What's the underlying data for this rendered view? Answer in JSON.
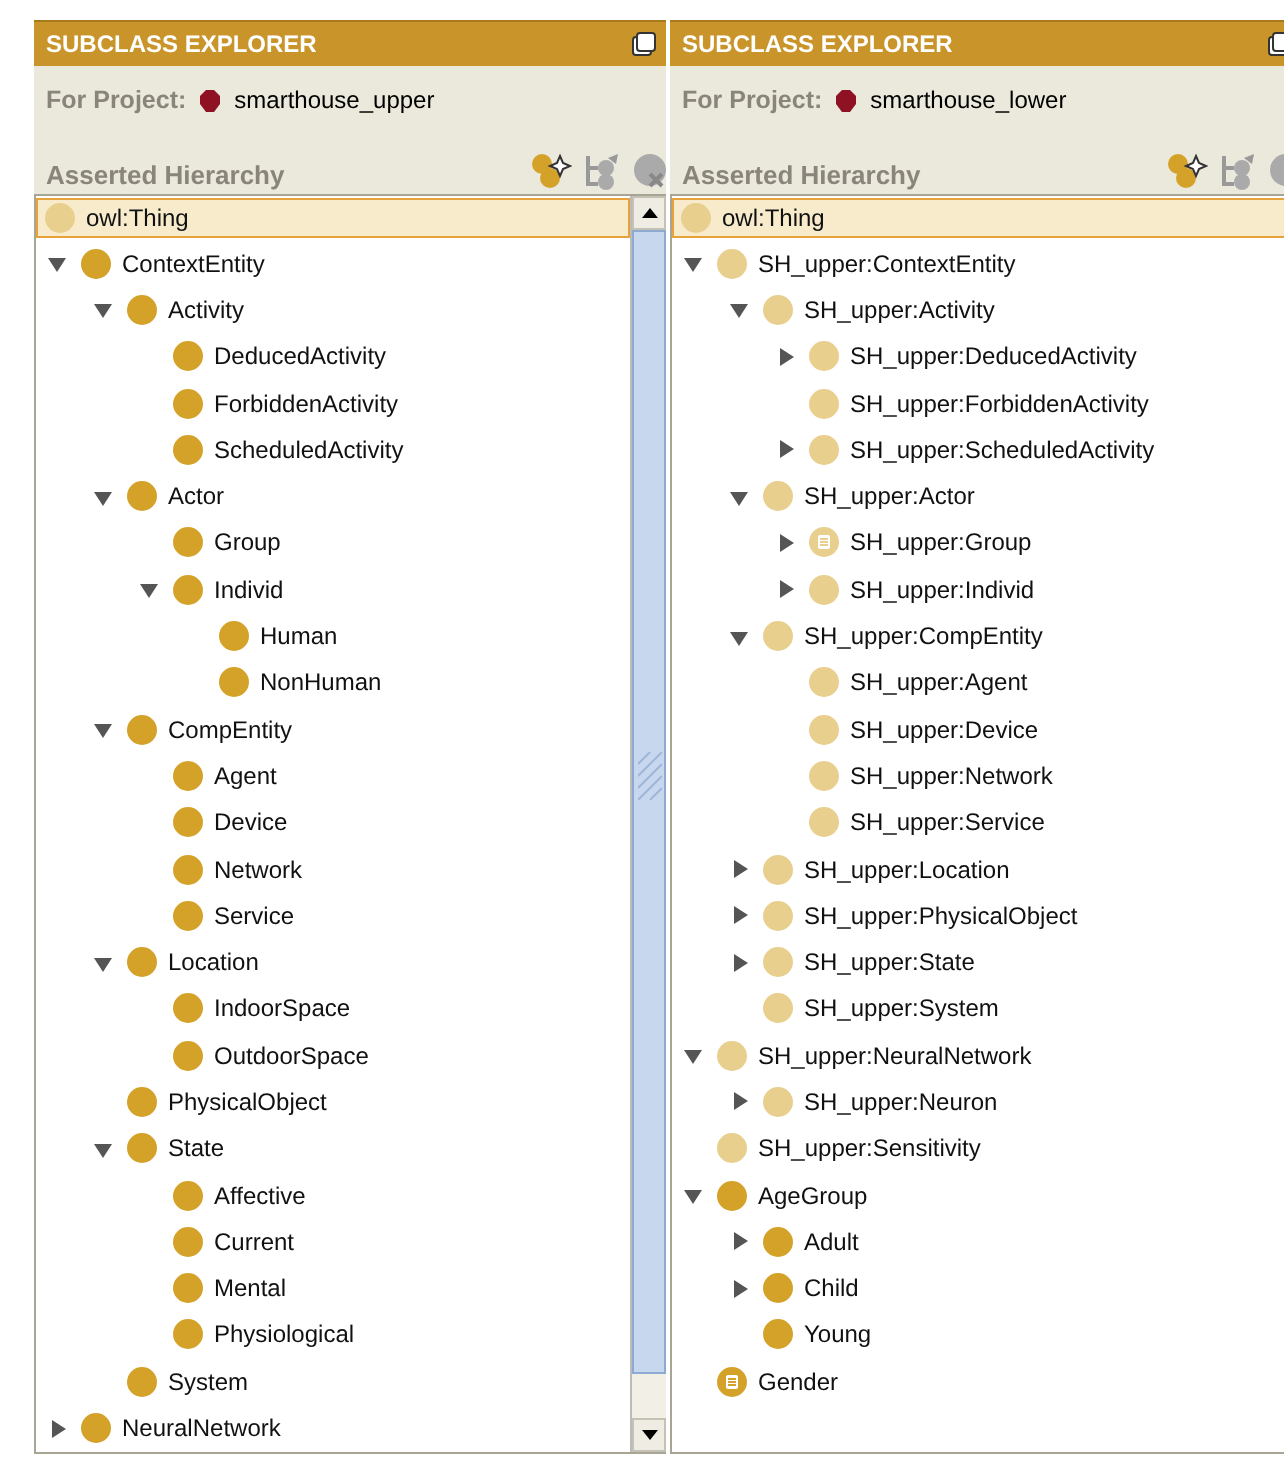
{
  "panels": [
    {
      "title": "SUBCLASS EXPLORER",
      "project_label": "For Project:",
      "project": "smarthouse_upper",
      "hierarchy_label": "Asserted Hierarchy",
      "scrollbar": true,
      "root": {
        "name": "owl:Thing",
        "kind": "system",
        "selected": true
      },
      "nodes": [
        {
          "name": "ContextEntity",
          "kind": "class",
          "expandable": true,
          "expanded": true,
          "children": [
            {
              "name": "Activity",
              "kind": "class",
              "expandable": true,
              "expanded": true,
              "children": [
                {
                  "name": "DeducedActivity",
                  "kind": "class",
                  "expandable": false
                },
                {
                  "name": "ForbiddenActivity",
                  "kind": "class",
                  "expandable": false
                },
                {
                  "name": "ScheduledActivity",
                  "kind": "class",
                  "expandable": false
                }
              ]
            },
            {
              "name": "Actor",
              "kind": "class",
              "expandable": true,
              "expanded": true,
              "children": [
                {
                  "name": "Group",
                  "kind": "class",
                  "expandable": false
                },
                {
                  "name": "Individ",
                  "kind": "class",
                  "expandable": true,
                  "expanded": true,
                  "children": [
                    {
                      "name": "Human",
                      "kind": "class",
                      "expandable": false
                    },
                    {
                      "name": "NonHuman",
                      "kind": "class",
                      "expandable": false
                    }
                  ]
                }
              ]
            },
            {
              "name": "CompEntity",
              "kind": "class",
              "expandable": true,
              "expanded": true,
              "children": [
                {
                  "name": "Agent",
                  "kind": "class",
                  "expandable": false
                },
                {
                  "name": "Device",
                  "kind": "class",
                  "expandable": false
                },
                {
                  "name": "Network",
                  "kind": "class",
                  "expandable": false
                },
                {
                  "name": "Service",
                  "kind": "class",
                  "expandable": false
                }
              ]
            },
            {
              "name": "Location",
              "kind": "class",
              "expandable": true,
              "expanded": true,
              "children": [
                {
                  "name": "IndoorSpace",
                  "kind": "class",
                  "expandable": false
                },
                {
                  "name": "OutdoorSpace",
                  "kind": "class",
                  "expandable": false
                }
              ]
            },
            {
              "name": "PhysicalObject",
              "kind": "class",
              "expandable": false
            },
            {
              "name": "State",
              "kind": "class",
              "expandable": true,
              "expanded": true,
              "children": [
                {
                  "name": "Affective",
                  "kind": "class",
                  "expandable": false
                },
                {
                  "name": "Current",
                  "kind": "class",
                  "expandable": false
                },
                {
                  "name": "Mental",
                  "kind": "class",
                  "expandable": false
                },
                {
                  "name": "Physiological",
                  "kind": "class",
                  "expandable": false
                }
              ]
            },
            {
              "name": "System",
              "kind": "class",
              "expandable": false
            }
          ]
        },
        {
          "name": "NeuralNetwork",
          "kind": "class",
          "expandable": true,
          "expanded": false
        }
      ]
    },
    {
      "title": "SUBCLASS EXPLORER",
      "project_label": "For Project:",
      "project": "smarthouse_lower",
      "hierarchy_label": "Asserted Hierarchy",
      "scrollbar": false,
      "root": {
        "name": "owl:Thing",
        "kind": "system",
        "selected": true
      },
      "nodes": [
        {
          "name": "SH_upper:ContextEntity",
          "kind": "imported",
          "expandable": true,
          "expanded": true,
          "children": [
            {
              "name": "SH_upper:Activity",
              "kind": "imported",
              "expandable": true,
              "expanded": true,
              "children": [
                {
                  "name": "SH_upper:DeducedActivity",
                  "kind": "imported",
                  "expandable": true,
                  "expanded": false
                },
                {
                  "name": "SH_upper:ForbiddenActivity",
                  "kind": "imported",
                  "expandable": false
                },
                {
                  "name": "SH_upper:ScheduledActivity",
                  "kind": "imported",
                  "expandable": true,
                  "expanded": false
                }
              ]
            },
            {
              "name": "SH_upper:Actor",
              "kind": "imported",
              "expandable": true,
              "expanded": true,
              "children": [
                {
                  "name": "SH_upper:Group",
                  "kind": "imported-defined",
                  "expandable": true,
                  "expanded": false
                },
                {
                  "name": "SH_upper:Individ",
                  "kind": "imported",
                  "expandable": true,
                  "expanded": false
                }
              ]
            },
            {
              "name": "SH_upper:CompEntity",
              "kind": "imported",
              "expandable": true,
              "expanded": true,
              "children": [
                {
                  "name": "SH_upper:Agent",
                  "kind": "imported",
                  "expandable": false
                },
                {
                  "name": "SH_upper:Device",
                  "kind": "imported",
                  "expandable": false
                },
                {
                  "name": "SH_upper:Network",
                  "kind": "imported",
                  "expandable": false
                },
                {
                  "name": "SH_upper:Service",
                  "kind": "imported",
                  "expandable": false
                }
              ]
            },
            {
              "name": "SH_upper:Location",
              "kind": "imported",
              "expandable": true,
              "expanded": false
            },
            {
              "name": "SH_upper:PhysicalObject",
              "kind": "imported",
              "expandable": true,
              "expanded": false
            },
            {
              "name": "SH_upper:State",
              "kind": "imported",
              "expandable": true,
              "expanded": false
            },
            {
              "name": "SH_upper:System",
              "kind": "imported",
              "expandable": false
            }
          ]
        },
        {
          "name": "SH_upper:NeuralNetwork",
          "kind": "imported",
          "expandable": true,
          "expanded": true,
          "children": [
            {
              "name": "SH_upper:Neuron",
              "kind": "imported",
              "expandable": true,
              "expanded": false
            }
          ]
        },
        {
          "name": "SH_upper:Sensitivity",
          "kind": "imported",
          "expandable": false
        },
        {
          "name": "AgeGroup",
          "kind": "class",
          "expandable": true,
          "expanded": true,
          "children": [
            {
              "name": "Adult",
              "kind": "class",
              "expandable": true,
              "expanded": false
            },
            {
              "name": "Child",
              "kind": "class",
              "expandable": true,
              "expanded": false
            },
            {
              "name": "Young",
              "kind": "class",
              "expandable": false
            }
          ]
        },
        {
          "name": "Gender",
          "kind": "defined",
          "expandable": false
        }
      ]
    }
  ]
}
